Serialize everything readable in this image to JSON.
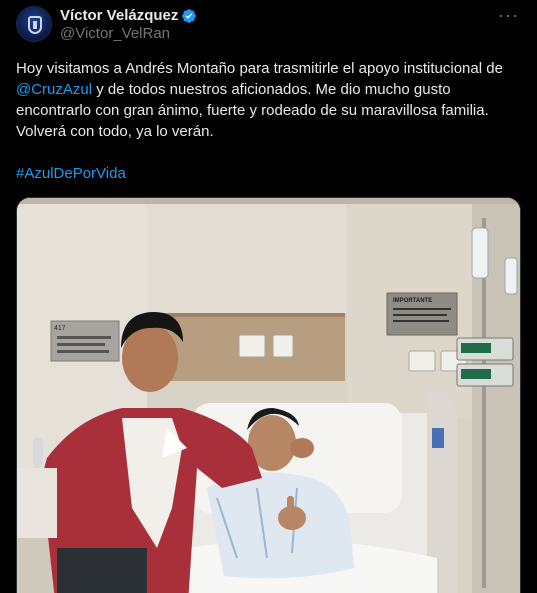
{
  "author": {
    "display_name": "Víctor Velázquez",
    "handle": "@Victor_VelRan",
    "verified": true,
    "avatar_icon": "team-crest-avatar"
  },
  "tweet": {
    "text_part1": "Hoy visitamos a Andrés Montaño para trasmitirle el apoyo institucional de ",
    "mention": "@CruzAzul",
    "text_part2": " y de todos nuestros aficionados. Me dio mucho gusto encontrarlo con gran ánimo, fuerte y rodeado de su maravillosa familia. Volverá con todo, ya lo verán.",
    "hashtag": "#AzulDePorVida"
  },
  "media": {
    "room_number": "417",
    "sign_label": "IMPORTANTE"
  },
  "colors": {
    "background": "#000000",
    "text": "#e7e9ea",
    "secondary": "#71767b",
    "accent": "#1d9bf0"
  }
}
